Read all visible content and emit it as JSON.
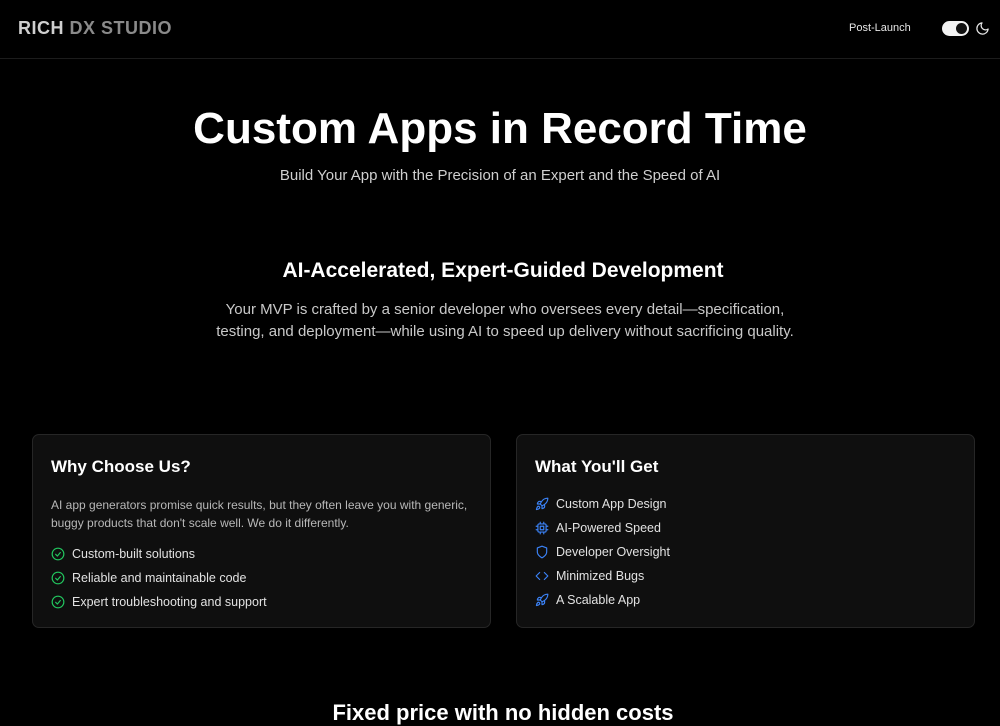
{
  "header": {
    "brand_part1": "RICH",
    "brand_part2": "DX STUDIO",
    "nav_link": "Post-Launch"
  },
  "hero": {
    "title": "Custom Apps in Record Time",
    "subtitle": "Build Your App with the Precision of an Expert and the Speed of AI"
  },
  "section": {
    "title": "AI-Accelerated, Expert-Guided Development",
    "text": "Your MVP is crafted by a senior developer who oversees every detail—specification, testing, and deployment—while using AI to speed up delivery without sacrificing quality."
  },
  "why_card": {
    "title": "Why Choose Us?",
    "description": "AI app generators promise quick results, but they often leave you with generic, buggy products that don't scale well. We do it differently.",
    "items": [
      {
        "icon": "check-circle-icon",
        "label": "Custom-built solutions"
      },
      {
        "icon": "check-circle-icon",
        "label": "Reliable and maintainable code"
      },
      {
        "icon": "check-circle-icon",
        "label": "Expert troubleshooting and support"
      }
    ]
  },
  "get_card": {
    "title": "What You'll Get",
    "items": [
      {
        "icon": "rocket-icon",
        "label": "Custom App Design"
      },
      {
        "icon": "cpu-icon",
        "label": "AI-Powered Speed"
      },
      {
        "icon": "shield-icon",
        "label": "Developer Oversight"
      },
      {
        "icon": "code-icon",
        "label": "Minimized Bugs"
      },
      {
        "icon": "rocket-icon",
        "label": "A Scalable App"
      }
    ]
  },
  "pricing": {
    "title": "Fixed price with no hidden costs"
  },
  "colors": {
    "background": "#000000",
    "check_green": "#22c55e",
    "icon_blue": "#3b82f6",
    "card_bg": "#0f0f0f"
  }
}
